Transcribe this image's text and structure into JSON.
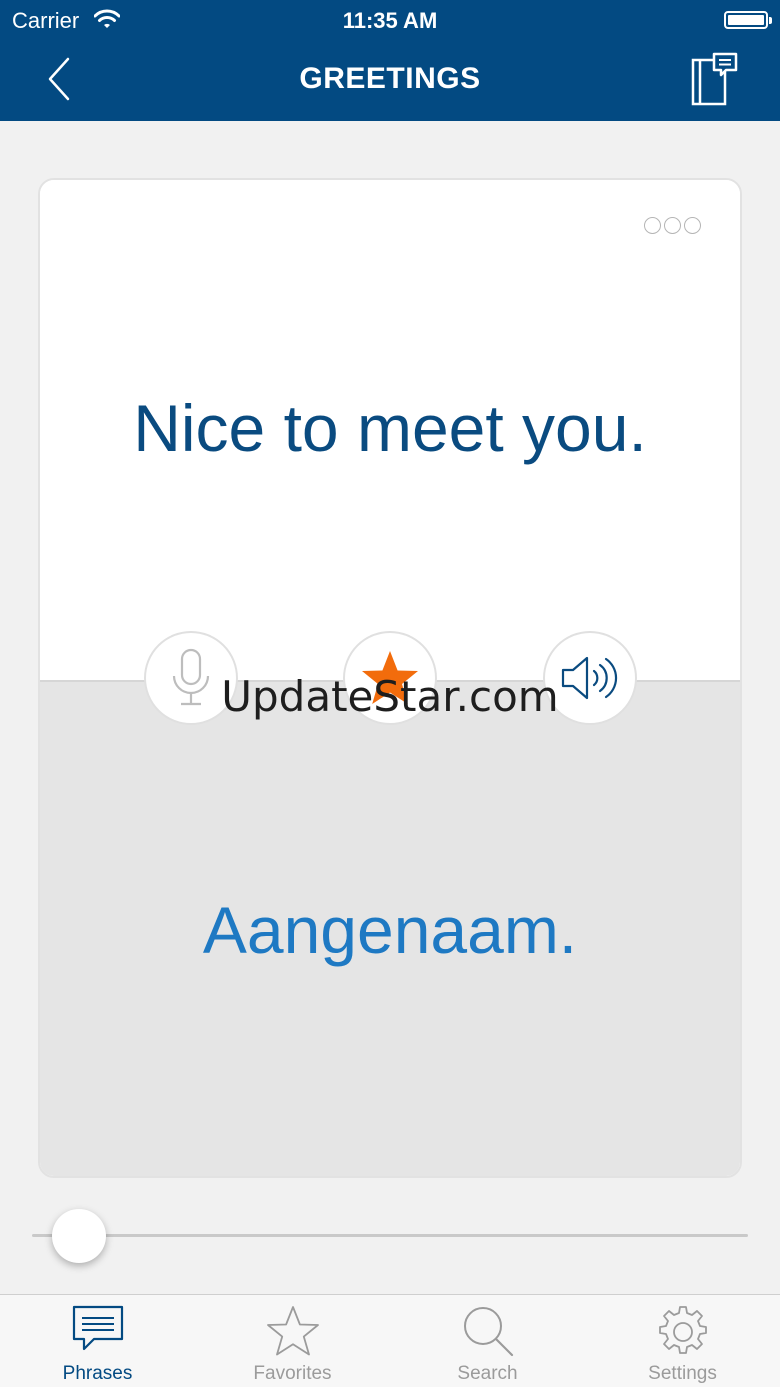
{
  "status_bar": {
    "carrier": "Carrier",
    "time": "11:35 AM",
    "battery_level": 1.0
  },
  "nav": {
    "title": "GREETINGS",
    "back_icon": "chevron-left-icon",
    "notes_icon": "notebook-icon"
  },
  "card": {
    "phrase": "Nice to meet you.",
    "translation": "Aangenaam.",
    "more_icon": "more-dots-icon",
    "actions": {
      "record_icon": "microphone-icon",
      "favorite_icon": "star-icon",
      "play_icon": "speaker-icon"
    },
    "favorite_color": "#f26c0c"
  },
  "watermark": "UpdateStar.com",
  "progress": {
    "position": 0.0
  },
  "tabs": [
    {
      "label": "Phrases",
      "icon": "speech-bubble-icon",
      "active": true
    },
    {
      "label": "Favorites",
      "icon": "star-icon",
      "active": false
    },
    {
      "label": "Search",
      "icon": "search-icon",
      "active": false
    },
    {
      "label": "Settings",
      "icon": "gear-icon",
      "active": false
    }
  ],
  "colors": {
    "brand": "#034a82",
    "phrase": "#0a4b80",
    "translation": "#1e79c3"
  }
}
